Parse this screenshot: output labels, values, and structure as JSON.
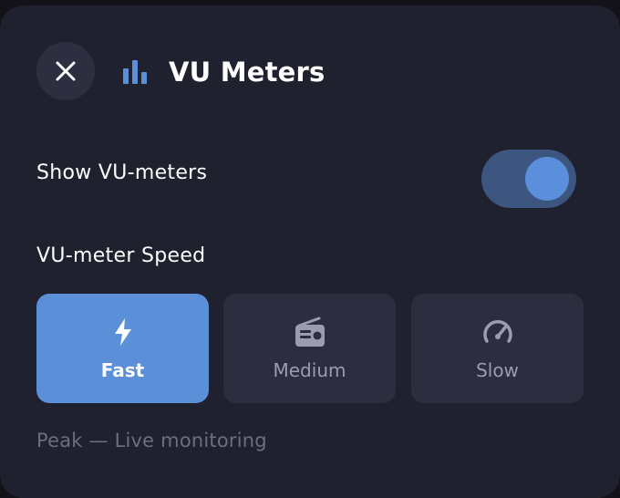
{
  "dialog": {
    "title": "VU Meters",
    "title_icon": "bar-chart-icon",
    "close_icon": "close-icon"
  },
  "show_vu_meters": {
    "label": "Show VU-meters",
    "enabled": true
  },
  "speed": {
    "label": "VU-meter Speed",
    "options": [
      {
        "label": "Fast",
        "icon": "lightning-icon",
        "selected": true
      },
      {
        "label": "Medium",
        "icon": "radio-icon",
        "selected": false
      },
      {
        "label": "Slow",
        "icon": "gauge-icon",
        "selected": false
      }
    ],
    "description": "Peak — Live monitoring"
  },
  "colors": {
    "accent": "#5b8fd7",
    "toggle_track": "#3d5680",
    "panel_bg": "#20212e",
    "option_bg": "#2c2e40"
  }
}
